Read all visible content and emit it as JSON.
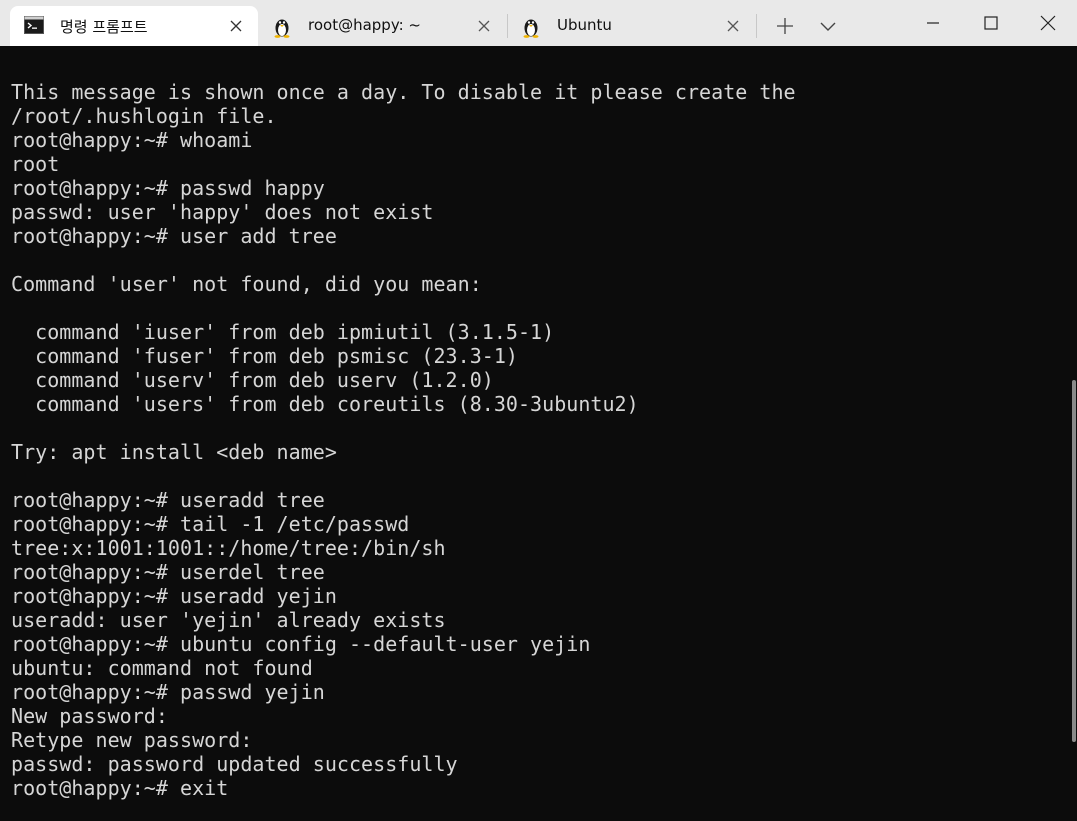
{
  "tabs": [
    {
      "label": "명령 프롬프트",
      "icon": "cmd-prompt-icon",
      "active": true
    },
    {
      "label": "root@happy: ~",
      "icon": "linux-penguin-icon",
      "active": false
    },
    {
      "label": "Ubuntu",
      "icon": "linux-penguin-icon",
      "active": false
    }
  ],
  "icons": {
    "close": "close-icon",
    "new_tab": "plus-icon",
    "dropdown": "chevron-down-icon",
    "minimize": "minimize-icon",
    "maximize": "maximize-icon",
    "window_close": "window-close-icon"
  },
  "terminal": {
    "lines": [
      "This message is shown once a day. To disable it please create the",
      "/root/.hushlogin file.",
      "root@happy:~# whoami",
      "root",
      "root@happy:~# passwd happy",
      "passwd: user 'happy' does not exist",
      "root@happy:~# user add tree",
      "",
      "Command 'user' not found, did you mean:",
      "",
      "  command 'iuser' from deb ipmiutil (3.1.5-1)",
      "  command 'fuser' from deb psmisc (23.3-1)",
      "  command 'userv' from deb userv (1.2.0)",
      "  command 'users' from deb coreutils (8.30-3ubuntu2)",
      "",
      "Try: apt install <deb name>",
      "",
      "root@happy:~# useradd tree",
      "root@happy:~# tail -1 /etc/passwd",
      "tree:x:1001:1001::/home/tree:/bin/sh",
      "root@happy:~# userdel tree",
      "root@happy:~# useradd yejin",
      "useradd: user 'yejin' already exists",
      "root@happy:~# ubuntu config --default-user yejin",
      "ubuntu: command not found",
      "root@happy:~# passwd yejin",
      "New password:",
      "Retype new password:",
      "passwd: password updated successfully",
      "root@happy:~# exit"
    ]
  },
  "colors": {
    "tabbar_bg": "#e9e9e9",
    "active_tab_bg": "#ffffff",
    "terminal_bg": "#0c0c0c",
    "terminal_text": "#d6d6d6"
  }
}
